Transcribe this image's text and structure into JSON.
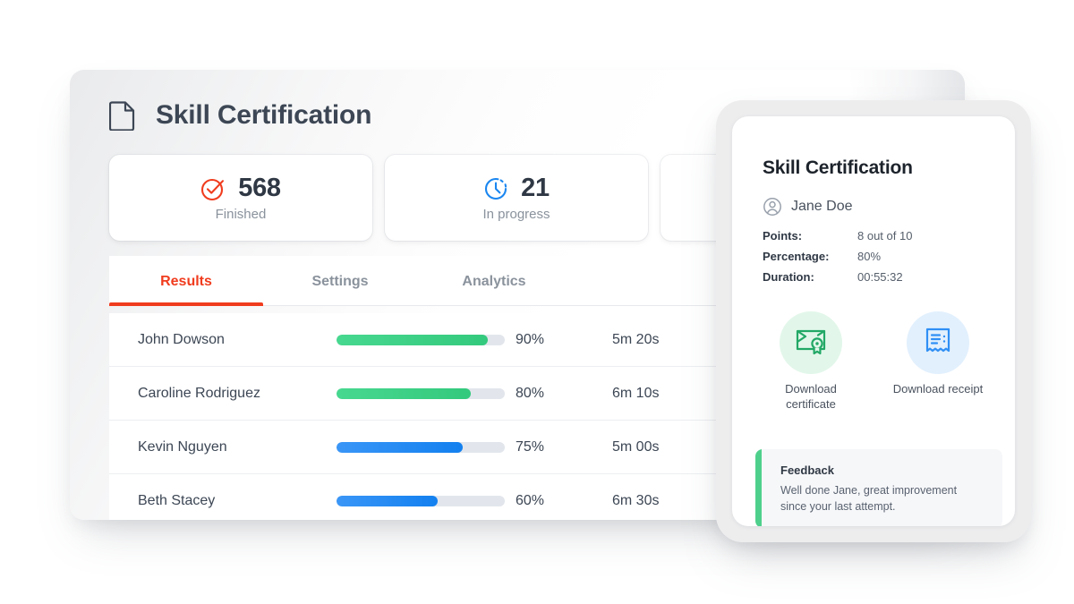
{
  "main": {
    "title": "Skill Certification",
    "title_icon": "document-icon",
    "stats": [
      {
        "icon": "check-circle-icon",
        "icon_color": "#f03c1e",
        "value": "568",
        "label": "Finished"
      },
      {
        "icon": "clock-icon",
        "icon_color": "#1a86f0",
        "value": "21",
        "label": "In progress"
      },
      {
        "icon": "",
        "icon_color": "",
        "value": "",
        "label": ""
      }
    ],
    "tabs": [
      {
        "label": "Results",
        "active": true
      },
      {
        "label": "Settings",
        "active": false
      },
      {
        "label": "Analytics",
        "active": false
      }
    ],
    "results": [
      {
        "name": "John Dowson",
        "percent": "90%",
        "value": 90,
        "time": "5m 20s",
        "color": "green"
      },
      {
        "name": "Caroline Rodriguez",
        "percent": "80%",
        "value": 80,
        "time": "6m 10s",
        "color": "green"
      },
      {
        "name": "Kevin Nguyen",
        "percent": "75%",
        "value": 75,
        "time": "5m 00s",
        "color": "blue"
      },
      {
        "name": "Beth Stacey",
        "percent": "60%",
        "value": 60,
        "time": "6m 30s",
        "color": "blue"
      }
    ]
  },
  "panel": {
    "title": "Skill Certification",
    "user_icon": "user-circle-icon",
    "user_name": "Jane Doe",
    "meta": [
      {
        "key": "Points:",
        "value": "8 out of 10"
      },
      {
        "key": "Percentage:",
        "value": "80%"
      },
      {
        "key": "Duration:",
        "value": "00:55:32"
      }
    ],
    "actions": [
      {
        "icon": "certificate-icon",
        "label": "Download certificate",
        "color": "green"
      },
      {
        "icon": "receipt-icon",
        "label": "Download receipt",
        "color": "blue"
      }
    ],
    "feedback": {
      "title": "Feedback",
      "text": "Well done Jane, great improvement since your last attempt."
    }
  },
  "colors": {
    "accent_red": "#f03c1e",
    "green": "#33c97d",
    "blue": "#1a86f0",
    "track": "#e2e6ec",
    "text_dark": "#3c4654",
    "text_muted": "#8a929c"
  }
}
